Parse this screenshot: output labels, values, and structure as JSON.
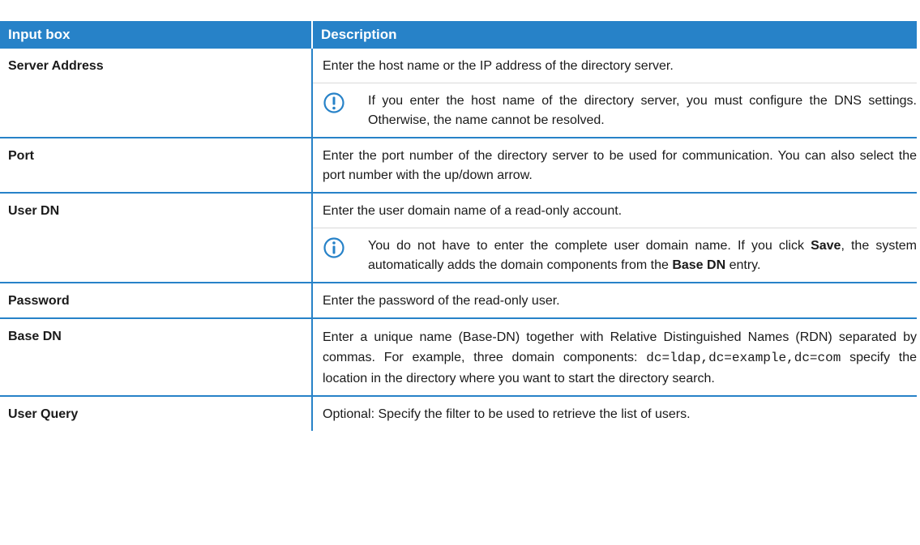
{
  "table": {
    "headers": [
      "Input box",
      "Description"
    ],
    "rows": {
      "server_address": {
        "key": "Server Address",
        "desc": "Enter the host name or the IP address of the directory server.",
        "note": "If you enter the host name of the directory server, you must configure the DNS settings. Otherwise, the name cannot be resolved.",
        "note_icon": "exclamation-circle-icon"
      },
      "port": {
        "key": "Port",
        "desc": "Enter the port number of the directory server to be used for communication. You can also select the port number with the up/down arrow."
      },
      "user_dn": {
        "key": "User DN",
        "desc": "Enter the user domain name of a read-only account.",
        "note_a": "You do not have to enter the complete user domain name. If you click ",
        "note_b": "Save",
        "note_c": ", the system automatically adds the domain components from the ",
        "note_d": "Base DN",
        "note_e": " entry.",
        "note_icon": "info-circle-icon"
      },
      "password": {
        "key": "Password",
        "desc": "Enter the password of the read-only user."
      },
      "base_dn": {
        "key": "Base DN",
        "desc_a": "Enter a unique name (Base-DN) together with Relative Distinguished Names (RDN) separated by commas. For example, three domain components: ",
        "desc_code": "dc=ldap,dc=example,dc=com",
        "desc_b": " specify the location in the directory where you want to start the directory search."
      },
      "user_query": {
        "key": "User Query",
        "desc": "Optional: Specify the filter to be used to retrieve the list of users."
      }
    }
  },
  "colors": {
    "header_bg": "#2782c8",
    "border": "#2782c8",
    "icon": "#2782c8"
  }
}
